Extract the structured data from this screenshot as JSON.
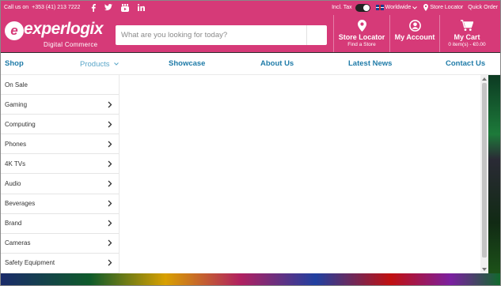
{
  "colors": {
    "brand": "#d63a78",
    "nav_link": "#1f7ba8",
    "nav_active": "#5aa6c9"
  },
  "topbar": {
    "call_label": "Call us on",
    "phone": "+353 (41) 213 7222",
    "social": [
      "facebook-icon",
      "twitter-icon",
      "youtube-icon",
      "linkedin-icon"
    ],
    "tax_label": "Incl. Tax",
    "region_label": "Worldwide",
    "store_locator_label": "Store Locator",
    "quick_order_label": "Quick Order"
  },
  "header": {
    "logo_mark": "e",
    "logo_text": "experlogix",
    "logo_sub": "Digital Commerce",
    "search_placeholder": "What are you looking for today?",
    "store_locator": {
      "title": "Store Locator",
      "sub": "Find a Store"
    },
    "account": {
      "title": "My Account"
    },
    "cart": {
      "title": "My Cart",
      "sub": "0 item(s) - €0.00"
    }
  },
  "nav": {
    "shop": "Shop",
    "products": "Products",
    "showcase": "Showcase",
    "about": "About Us",
    "news": "Latest News",
    "contact": "Contact Us"
  },
  "sidebar": {
    "items": [
      {
        "label": "On Sale",
        "has_children": false
      },
      {
        "label": "Gaming",
        "has_children": true
      },
      {
        "label": "Computing",
        "has_children": true
      },
      {
        "label": "Phones",
        "has_children": true
      },
      {
        "label": "4K TVs",
        "has_children": true
      },
      {
        "label": "Audio",
        "has_children": true
      },
      {
        "label": "Beverages",
        "has_children": true
      },
      {
        "label": "Brand",
        "has_children": true
      },
      {
        "label": "Cameras",
        "has_children": true
      },
      {
        "label": "Safety Equipment",
        "has_children": true
      }
    ]
  }
}
